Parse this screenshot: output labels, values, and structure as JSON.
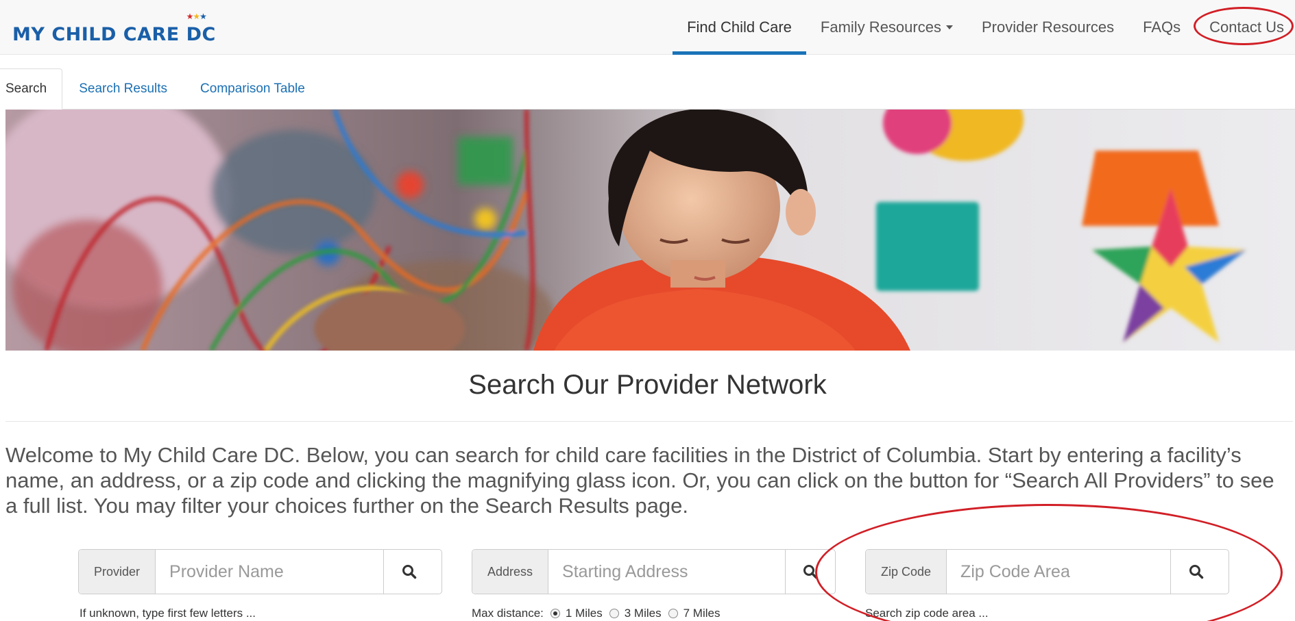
{
  "header": {
    "logo_main": "MY CHILD CARE ",
    "logo_dc": "DC",
    "nav": [
      {
        "label": "Find Child Care"
      },
      {
        "label": "Family Resources"
      },
      {
        "label": "Provider Resources"
      },
      {
        "label": "FAQs"
      },
      {
        "label": "Contact Us"
      }
    ]
  },
  "tabs": [
    {
      "label": "Search"
    },
    {
      "label": "Search Results"
    },
    {
      "label": "Comparison Table"
    }
  ],
  "page_title": "Search Our Provider Network",
  "intro": "Welcome to My Child Care DC. Below, you can search for child care facilities in the District of Columbia. Start by entering a facility’s name, an address, or a zip code and clicking the magnifying glass icon. Or, you can click on the button for “Search All Providers” to see a full list. You may filter your choices further on the Search Results page.",
  "search": {
    "provider": {
      "addon": "Provider",
      "placeholder": "Provider Name",
      "help": "If unknown, type first few letters ..."
    },
    "address": {
      "addon": "Address",
      "placeholder": "Starting Address",
      "max_distance_label": "Max distance:",
      "options": [
        "1 Miles",
        "3 Miles",
        "7 Miles"
      ],
      "selected": "1 Miles"
    },
    "zip": {
      "addon": "Zip Code",
      "placeholder": "Zip Code Area",
      "help": "Search zip code area ..."
    }
  },
  "colors": {
    "brand_blue": "#1a5fa8",
    "link_blue": "#1a6fb3",
    "active_underline": "#1a73b8",
    "annotation_red": "#d11f26"
  },
  "icons": [
    "search-icon",
    "caret-down-icon",
    "star-icon"
  ]
}
